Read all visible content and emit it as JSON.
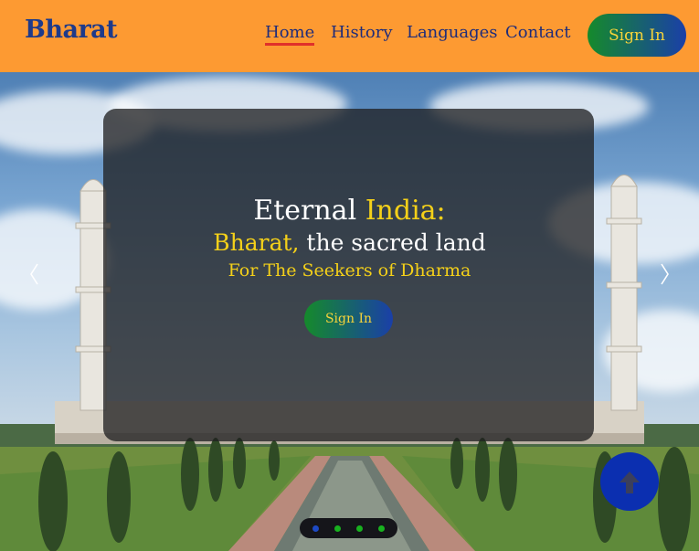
{
  "header": {
    "logo": "Bharat",
    "nav": [
      {
        "label": "Home",
        "active": true
      },
      {
        "label": "History",
        "active": false
      },
      {
        "label": "Languages",
        "active": false
      },
      {
        "label": "Contact",
        "active": false
      }
    ],
    "signin_label": "Sign In"
  },
  "hero": {
    "title_part1": "Eternal ",
    "title_part2": "India:",
    "subtitle_part1": "Bharat,",
    "subtitle_part2": " the sacred land",
    "tagline": "For The Seekers of Dharma",
    "signin_label": "Sign In",
    "prev_icon": "chevron-left-icon",
    "next_icon": "chevron-right-icon",
    "slide_count": 4,
    "active_slide": 1
  },
  "scroll_top_icon": "arrow-up-icon",
  "colors": {
    "header_bg": "#fd9a32",
    "brand_blue": "#1e3a8a",
    "accent_gold": "#f4d019",
    "button_gradient_start": "#158a2b",
    "button_gradient_end": "#1a3fa8",
    "active_underline": "#e0302a",
    "scroll_button": "#0b2fb0"
  }
}
